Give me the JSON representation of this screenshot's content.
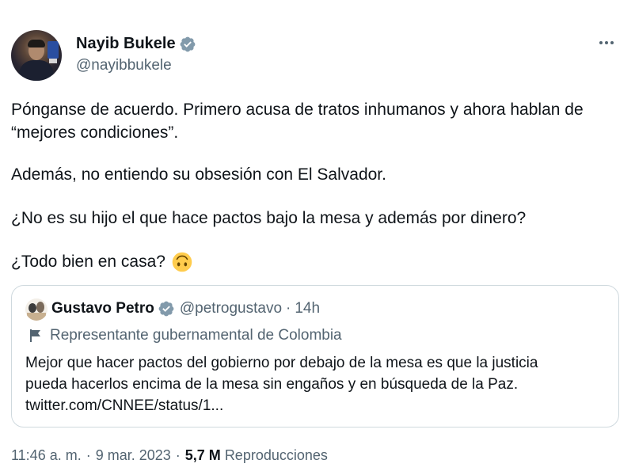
{
  "author": {
    "display_name": "Nayib Bukele",
    "handle": "@nayibbukele",
    "verified_icon": "verified-badge-icon",
    "verified_color": "#829aab"
  },
  "more_icon": "more-horizontal-icon",
  "body": {
    "paragraph1": "Pónganse de acuerdo. Primero acusa de tratos inhumanos y ahora hablan de “mejores condiciones”.",
    "paragraph2": "Además, no entiendo su obsesión con El Salvador.",
    "paragraph3": "¿No es su hijo el que hace pactos bajo la mesa y además por dinero?",
    "paragraph4": "¿Todo bien en casa?",
    "emoji": "upside-down-face-emoji"
  },
  "quote": {
    "display_name": "Gustavo Petro",
    "handle": "@petrogustavo",
    "separator": "·",
    "time": "14h",
    "label_icon": "flag-icon",
    "label": "Representante gubernamental de Colombia",
    "text_line1": "Mejor que hacer pactos del gobierno por debajo de la mesa es que la justicia",
    "text_line2": "pueda hacerlos encima de la mesa sin engaños y en búsqueda de la Paz.",
    "text_line3": "twitter.com/CNNEE/status/1..."
  },
  "footer": {
    "time": "11:46 a. m.",
    "separator1": "·",
    "date": "9 mar. 2023",
    "separator2": "·",
    "views_count": "5,7 M",
    "views_label": "Reproducciones"
  },
  "colors": {
    "text_primary": "#0f1419",
    "text_secondary": "#536471",
    "border": "#cfd9de",
    "badge_gray": "#829aab"
  }
}
